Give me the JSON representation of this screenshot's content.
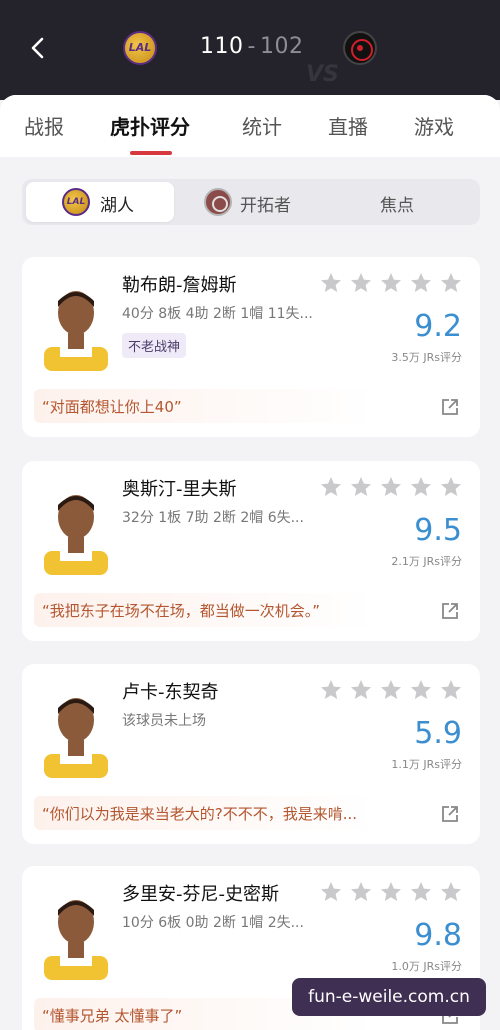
{
  "header": {
    "home_team_logo_text": "LAL",
    "home_score": "110",
    "separator": "-",
    "away_score": "102",
    "vs_text": "VS"
  },
  "tabs": [
    {
      "label": "战报"
    },
    {
      "label": "虎扑评分"
    },
    {
      "label": "统计"
    },
    {
      "label": "直播"
    },
    {
      "label": "游戏"
    }
  ],
  "segment": {
    "home_logo_text": "LAL",
    "items": [
      {
        "label": "湖人"
      },
      {
        "label": "开拓者"
      },
      {
        "label": "焦点"
      }
    ]
  },
  "players": [
    {
      "name": "勒布朗-詹姆斯",
      "stats": "40分 8板 4助 2断 1帽 11失...",
      "badge": "不老战神",
      "rating": "9.2",
      "votes": "3.5万 JRs评分",
      "quote": "“对面都想让你上40”",
      "stars_filled": 0
    },
    {
      "name": "奥斯汀-里夫斯",
      "stats": "32分 1板 7助 2断 2帽 6失...",
      "badge": "",
      "rating": "9.5",
      "votes": "2.1万 JRs评分",
      "quote": "“我把东子在场不在场，都当做一次机会。”",
      "stars_filled": 0
    },
    {
      "name": "卢卡-东契奇",
      "stats": "该球员未上场",
      "badge": "",
      "rating": "5.9",
      "votes": "1.1万 JRs评分",
      "quote": "“你们以为我是来当老大的?不不不，我是来啃...",
      "stars_filled": 0
    },
    {
      "name": "多里安-芬尼-史密斯",
      "stats": "10分 6板 0助 2断 1帽 2失...",
      "badge": "",
      "rating": "9.8",
      "votes": "1.0万 JRs评分",
      "quote": "“懂事兄弟 太懂事了”",
      "stars_filled": 0
    }
  ],
  "watermark": "fun-e-weile.com.cn",
  "colors": {
    "header_bg": "#24232b",
    "accent_red": "#d63a3f",
    "rating_blue": "#3b8fd1",
    "quote_orange": "#b4562f",
    "star_gray": "#c9c9cc"
  },
  "icons": {
    "back": "chevron-left-icon",
    "share": "share-icon",
    "star": "star-icon"
  }
}
